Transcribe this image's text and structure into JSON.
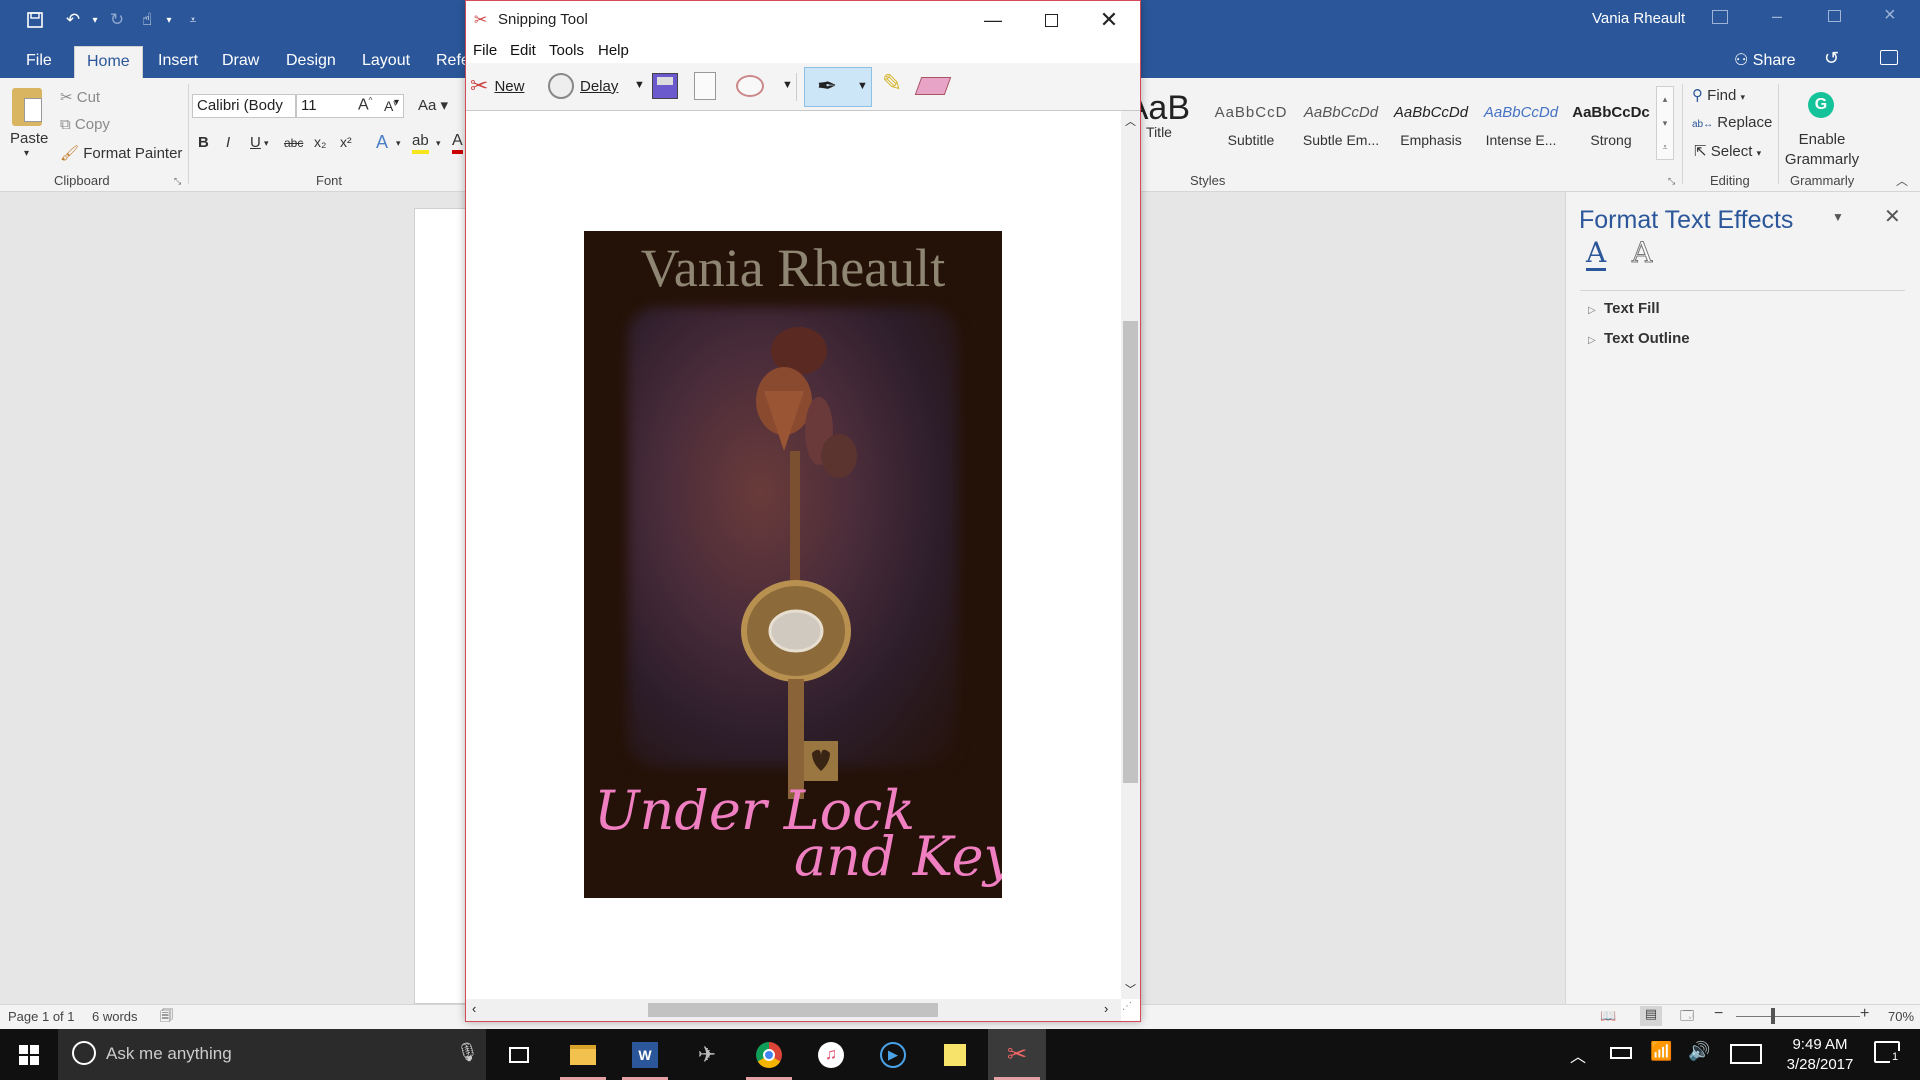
{
  "word": {
    "title_user": "Vania Rheault",
    "tabs": [
      {
        "label": "File"
      },
      {
        "label": "Home"
      },
      {
        "label": "Insert"
      },
      {
        "label": "Draw"
      },
      {
        "label": "Design"
      },
      {
        "label": "Layout"
      },
      {
        "label": "Refe"
      }
    ],
    "share_label": "Share",
    "clipboard": {
      "paste": "Paste",
      "cut": "Cut",
      "copy": "Copy",
      "format_painter": "Format Painter",
      "group": "Clipboard"
    },
    "font": {
      "name": "Calibri (Body",
      "size": "11",
      "group": "Font",
      "bold": "B",
      "italic": "I",
      "underline": "U",
      "strike": "abc",
      "sub": "x₂",
      "sup": "x²",
      "grow": "A",
      "shrink": "A",
      "case": "Aa"
    },
    "styles": {
      "group": "Styles",
      "items": [
        {
          "sample": "AaB",
          "name": "Title"
        },
        {
          "sample": "AaBbCcD",
          "name": "Subtitle"
        },
        {
          "sample": "AaBbCcDd",
          "name": "Subtle Em..."
        },
        {
          "sample": "AaBbCcDd",
          "name": "Emphasis"
        },
        {
          "sample": "AaBbCcDd",
          "name": "Intense E..."
        },
        {
          "sample": "AaBbCcDc",
          "name": "Strong"
        }
      ]
    },
    "editing": {
      "find": "Find",
      "replace": "Replace",
      "select": "Select",
      "group": "Editing"
    },
    "grammarly": {
      "line1": "Enable",
      "line2": "Grammarly",
      "group": "Grammarly"
    },
    "pane": {
      "title": "Format Text Effects",
      "items": [
        {
          "label": "Text Fill"
        },
        {
          "label": "Text Outline"
        }
      ]
    },
    "status": {
      "page": "Page 1 of 1",
      "words": "6 words",
      "zoom": "70%"
    }
  },
  "snip": {
    "title": "Snipping Tool",
    "menu": [
      {
        "label": "File"
      },
      {
        "label": "Edit"
      },
      {
        "label": "Tools"
      },
      {
        "label": "Help"
      }
    ],
    "new_label": "New",
    "delay_label": "Delay",
    "cover": {
      "author": "Vania Rheault",
      "line1": "Under Lock",
      "line2": "and Key"
    }
  },
  "taskbar": {
    "search_placeholder": "Ask me anything",
    "time": "9:49 AM",
    "date": "3/28/2017",
    "notification_count": "1"
  },
  "colors": {
    "word_blue": "#2b579a",
    "snip_border": "#d24b56",
    "cover_bg": "#241208",
    "cover_pink": "#f07fc2"
  }
}
